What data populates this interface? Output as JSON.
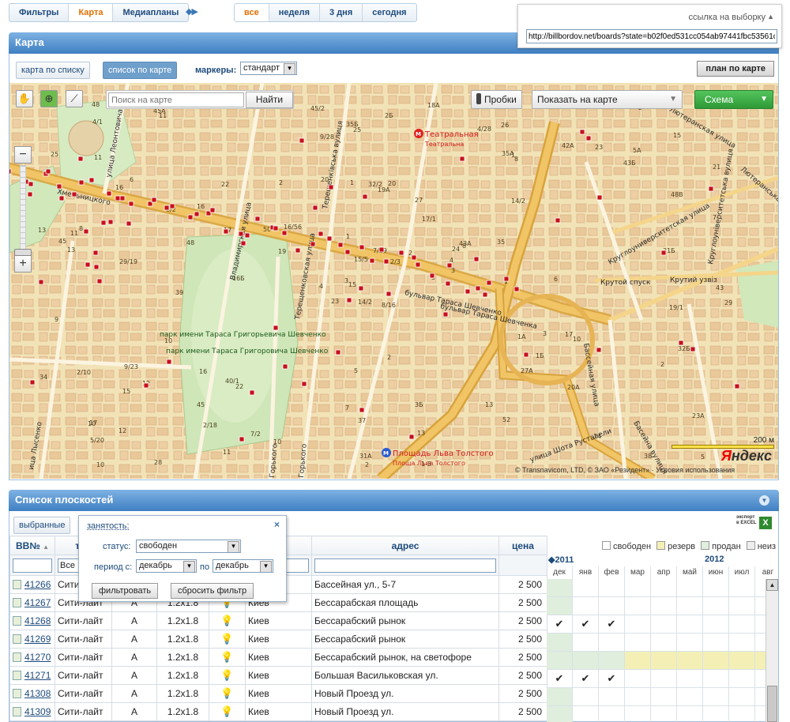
{
  "nav": {
    "main_tabs": [
      "Фильтры",
      "Карта",
      "Медиапланы"
    ],
    "active_main": 1,
    "arrows": "◆▶",
    "period_tabs": [
      "все",
      "неделя",
      "3 дня",
      "сегодня"
    ],
    "active_period": 0
  },
  "link_box": {
    "label": "ссылка на выборку",
    "toggle": "▲",
    "url": "http://billbordov.net/boards?state=b02f0ed531cc054ab97441fbc53561c9"
  },
  "map_panel": {
    "title": "Карта",
    "btn_list_map": "карта по списку",
    "btn_map_list": "список по карте",
    "markers_label": "маркеры:",
    "markers_value": "стандарт",
    "plan_button": "план по карте"
  },
  "map": {
    "search_placeholder": "Поиск на карте",
    "search_button": "Найти",
    "traffic_button": "Пробки",
    "show_on_map": "Показать на карте",
    "scheme_button": "Схема",
    "zoom_in": "+",
    "zoom_out": "−",
    "scale_label": "200 м",
    "copyright": "© Transnavicom, LTD, © ЗАО «Резидент» · Условия использования",
    "logo_ya": "Я",
    "logo_rest": "ндекс",
    "labels": {
      "metro_teatralna": "Театральная",
      "metro_teatralna_ua": "Театральна",
      "metro_tolstogo": "Площадь Льва Толстого",
      "metro_tolstogo_ua": "Площа Льва Толстого",
      "park_ua": "парк имени Тараса Григорьевича Шевченко",
      "park_ru": "парк имени Тараса Григоровича Шевченко",
      "blvd1": "бульвар Тараса Шевченко",
      "blvd2": "бульвар Тараса Шевченка",
      "volodymyrska": "Владимирская улица",
      "tereshchenkivska": "Терещенковская улица",
      "tereshchenkivska_ua": "Терещенківська вулиця",
      "leontovycha": "улица Леонтовича",
      "basseina": "Бассейная улица",
      "basseina_ua": "Басейна вулиця",
      "kruty": "Крутой спуск",
      "kruty_ua": "Крутий узвіз",
      "lyuteranska": "Лютеранская улица",
      "lyuteranska_ua": "Лютеранська вулиця",
      "universytetska": "Круглоуниверситетская улица",
      "universytetska_ua": "Круглоуніверситетська вулиця",
      "rustaveli": "улица Шота Руставели",
      "gorkogo": "Горького",
      "gorkogo_ua": "Горького",
      "khmelnytskogo": "Хмельницкого",
      "lysenka": "ица Лысенко"
    },
    "house_numbers": [
      "8/16",
      "16",
      "15",
      "17",
      "24",
      "22",
      "26",
      "20",
      "1",
      "3",
      "11",
      "5",
      "29/19",
      "21",
      "23",
      "14/2",
      "28",
      "1",
      "17/1",
      "12",
      "16/56",
      "5/20",
      "2/18",
      "32/2",
      "8",
      "10",
      "6",
      "25",
      "13",
      "1A",
      "7",
      "3",
      "7",
      "15/5",
      "22",
      "42A",
      "40/1",
      "38",
      "23A",
      "17",
      "18A",
      "50",
      "48",
      "27A",
      "11",
      "13",
      "4",
      "10",
      "37",
      "3",
      "15",
      "48B",
      "25",
      "1Б",
      "52",
      "45",
      "45A",
      "48",
      "3Б",
      "5А",
      "2Б",
      "16Б",
      "8",
      "16",
      "23",
      "5",
      "4/28",
      "9/28",
      "7/29",
      "34",
      "5",
      "10",
      "3",
      "17",
      "10",
      "4/1",
      "6/2",
      "9",
      "1",
      "13",
      "2",
      "12",
      "1",
      "32Б",
      "31A",
      "31Б",
      "2",
      "14",
      "1-3",
      "13",
      "35Б",
      "29",
      "35",
      "20A",
      "2/3",
      "2",
      "11",
      "2",
      "35A",
      "8",
      "39",
      "41",
      "43",
      "45",
      "10",
      "16",
      "7/2",
      "43A",
      "43Б",
      "19",
      "19/1",
      "11",
      "19A",
      "4",
      "12",
      "2/10",
      "14/2",
      "15",
      "20",
      "45/2",
      "9/23",
      "2",
      "27",
      "2",
      "6"
    ],
    "marker_count": 96
  },
  "list_panel": {
    "title": "Список плоскостей",
    "chosen_button": "выбранные",
    "excel_line1": "экспорт",
    "excel_line2": "в EXCEL",
    "excel_icon": "X",
    "columns": [
      "BB№",
      "тип",
      "",
      "",
      "",
      "",
      "адрес",
      "цена"
    ],
    "filter_type": "Все",
    "rows": [
      {
        "id": "41266",
        "type": "Сити-лайт",
        "side": "A",
        "size": "1.2x1.8",
        "city": "Киев",
        "address": "Бассейная ул., 5-7",
        "price": "2 500"
      },
      {
        "id": "41267",
        "type": "Сити-лайт",
        "side": "A",
        "size": "1.2x1.8",
        "city": "Киев",
        "address": "Бессарабская площадь",
        "price": "2 500"
      },
      {
        "id": "41268",
        "type": "Сити-лайт",
        "side": "A",
        "size": "1.2x1.8",
        "city": "Киев",
        "address": "Бессарабский рынок",
        "price": "2 500"
      },
      {
        "id": "41269",
        "type": "Сити-лайт",
        "side": "A",
        "size": "1.2x1.8",
        "city": "Киев",
        "address": "Бессарабский рынок",
        "price": "2 500"
      },
      {
        "id": "41270",
        "type": "Сити-лайт",
        "side": "A",
        "size": "1.2x1.8",
        "city": "Киев",
        "address": "Бессарабский рынок, на светофоре",
        "price": "2 500"
      },
      {
        "id": "41271",
        "type": "Сити-лайт",
        "side": "A",
        "size": "1.2x1.8",
        "city": "Киев",
        "address": "Большая Васильковская ул.",
        "price": "2 500"
      },
      {
        "id": "41308",
        "type": "Сити-лайт",
        "side": "A",
        "size": "1.2x1.8",
        "city": "Киев",
        "address": "Новый Проезд ул.",
        "price": "2 500"
      },
      {
        "id": "41309",
        "type": "Сити-лайт",
        "side": "A",
        "size": "1.2x1.8",
        "city": "Киев",
        "address": "Новый Проезд ул.",
        "price": "2 500"
      }
    ]
  },
  "calendar": {
    "legend": [
      {
        "label": "свободен",
        "color": "#ffffff"
      },
      {
        "label": "резерв",
        "color": "#f4f0b5"
      },
      {
        "label": "продан",
        "color": "#dfeedd"
      },
      {
        "label": "неиз",
        "color": "#eeeeee"
      }
    ],
    "year1": "◆2011",
    "year2": "2012",
    "months": [
      "дек",
      "янв",
      "фев",
      "мар",
      "апр",
      "май",
      "июн",
      "июл",
      "авг"
    ],
    "check": "✔",
    "rows": [
      [
        "green",
        "",
        "",
        "",
        "",
        "",
        "",
        "",
        ""
      ],
      [
        "green",
        "",
        "",
        "",
        "",
        "",
        "",
        "",
        ""
      ],
      [
        "check",
        "check",
        "check",
        "",
        "",
        "",
        "",
        "",
        ""
      ],
      [
        "green",
        "",
        "",
        "",
        "",
        "",
        "",
        "",
        ""
      ],
      [
        "green",
        "green",
        "green",
        "yellow",
        "yellow",
        "yellow",
        "yellow",
        "yellow",
        "yellow"
      ],
      [
        "check",
        "check",
        "check",
        "",
        "",
        "",
        "",
        "",
        ""
      ],
      [
        "green",
        "",
        "",
        "",
        "",
        "",
        "",
        "",
        ""
      ],
      [
        "green",
        "",
        "",
        "",
        "",
        "",
        "",
        "",
        ""
      ]
    ]
  },
  "filter_popup": {
    "title": "занятость:",
    "close": "×",
    "status_label": "статус:",
    "status_value": "свободен",
    "period_label": "период с:",
    "period_from": "декабрь",
    "period_to_label": "по",
    "period_to": "декабрь",
    "apply_button": "фильтровать",
    "reset_button": "сбросить фильтр"
  }
}
